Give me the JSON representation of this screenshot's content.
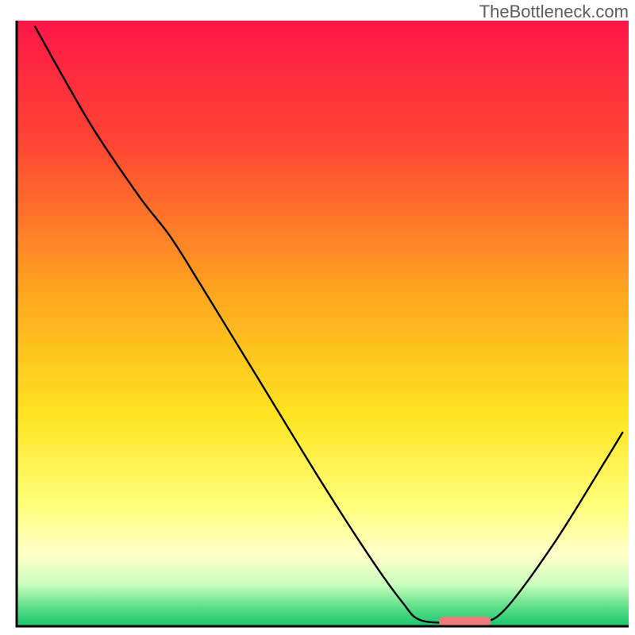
{
  "watermark": "TheBottleneck.com",
  "chart_data": {
    "type": "line",
    "title": "",
    "xlabel": "",
    "ylabel": "",
    "xlim": [
      0,
      100
    ],
    "ylim": [
      0,
      100
    ],
    "gradient_stops": [
      {
        "offset": 0,
        "color": "#ff1748"
      },
      {
        "offset": 20,
        "color": "#ff4433"
      },
      {
        "offset": 45,
        "color": "#ffa61f"
      },
      {
        "offset": 65,
        "color": "#ffe41f"
      },
      {
        "offset": 80,
        "color": "#ffff7a"
      },
      {
        "offset": 88,
        "color": "#ffffc8"
      },
      {
        "offset": 93,
        "color": "#ccffbe"
      },
      {
        "offset": 97,
        "color": "#58dd88"
      },
      {
        "offset": 100,
        "color": "#19c56e"
      }
    ],
    "curve": [
      {
        "x": 3.0,
        "y": 99.0
      },
      {
        "x": 12.0,
        "y": 83.0
      },
      {
        "x": 20.0,
        "y": 71.0
      },
      {
        "x": 25.0,
        "y": 64.5
      },
      {
        "x": 30.0,
        "y": 56.5
      },
      {
        "x": 40.0,
        "y": 40.0
      },
      {
        "x": 50.0,
        "y": 23.5
      },
      {
        "x": 58.0,
        "y": 11.0
      },
      {
        "x": 63.0,
        "y": 4.0
      },
      {
        "x": 66.0,
        "y": 1.0
      },
      {
        "x": 72.0,
        "y": 0.6
      },
      {
        "x": 76.0,
        "y": 0.6
      },
      {
        "x": 80.0,
        "y": 3.0
      },
      {
        "x": 88.0,
        "y": 14.0
      },
      {
        "x": 96.0,
        "y": 27.0
      },
      {
        "x": 99.0,
        "y": 32.0
      }
    ],
    "marker": {
      "x_start": 69.0,
      "x_end": 77.5,
      "y": 0.8,
      "color": "#ee7a7f"
    },
    "axes_color": "#000000"
  }
}
